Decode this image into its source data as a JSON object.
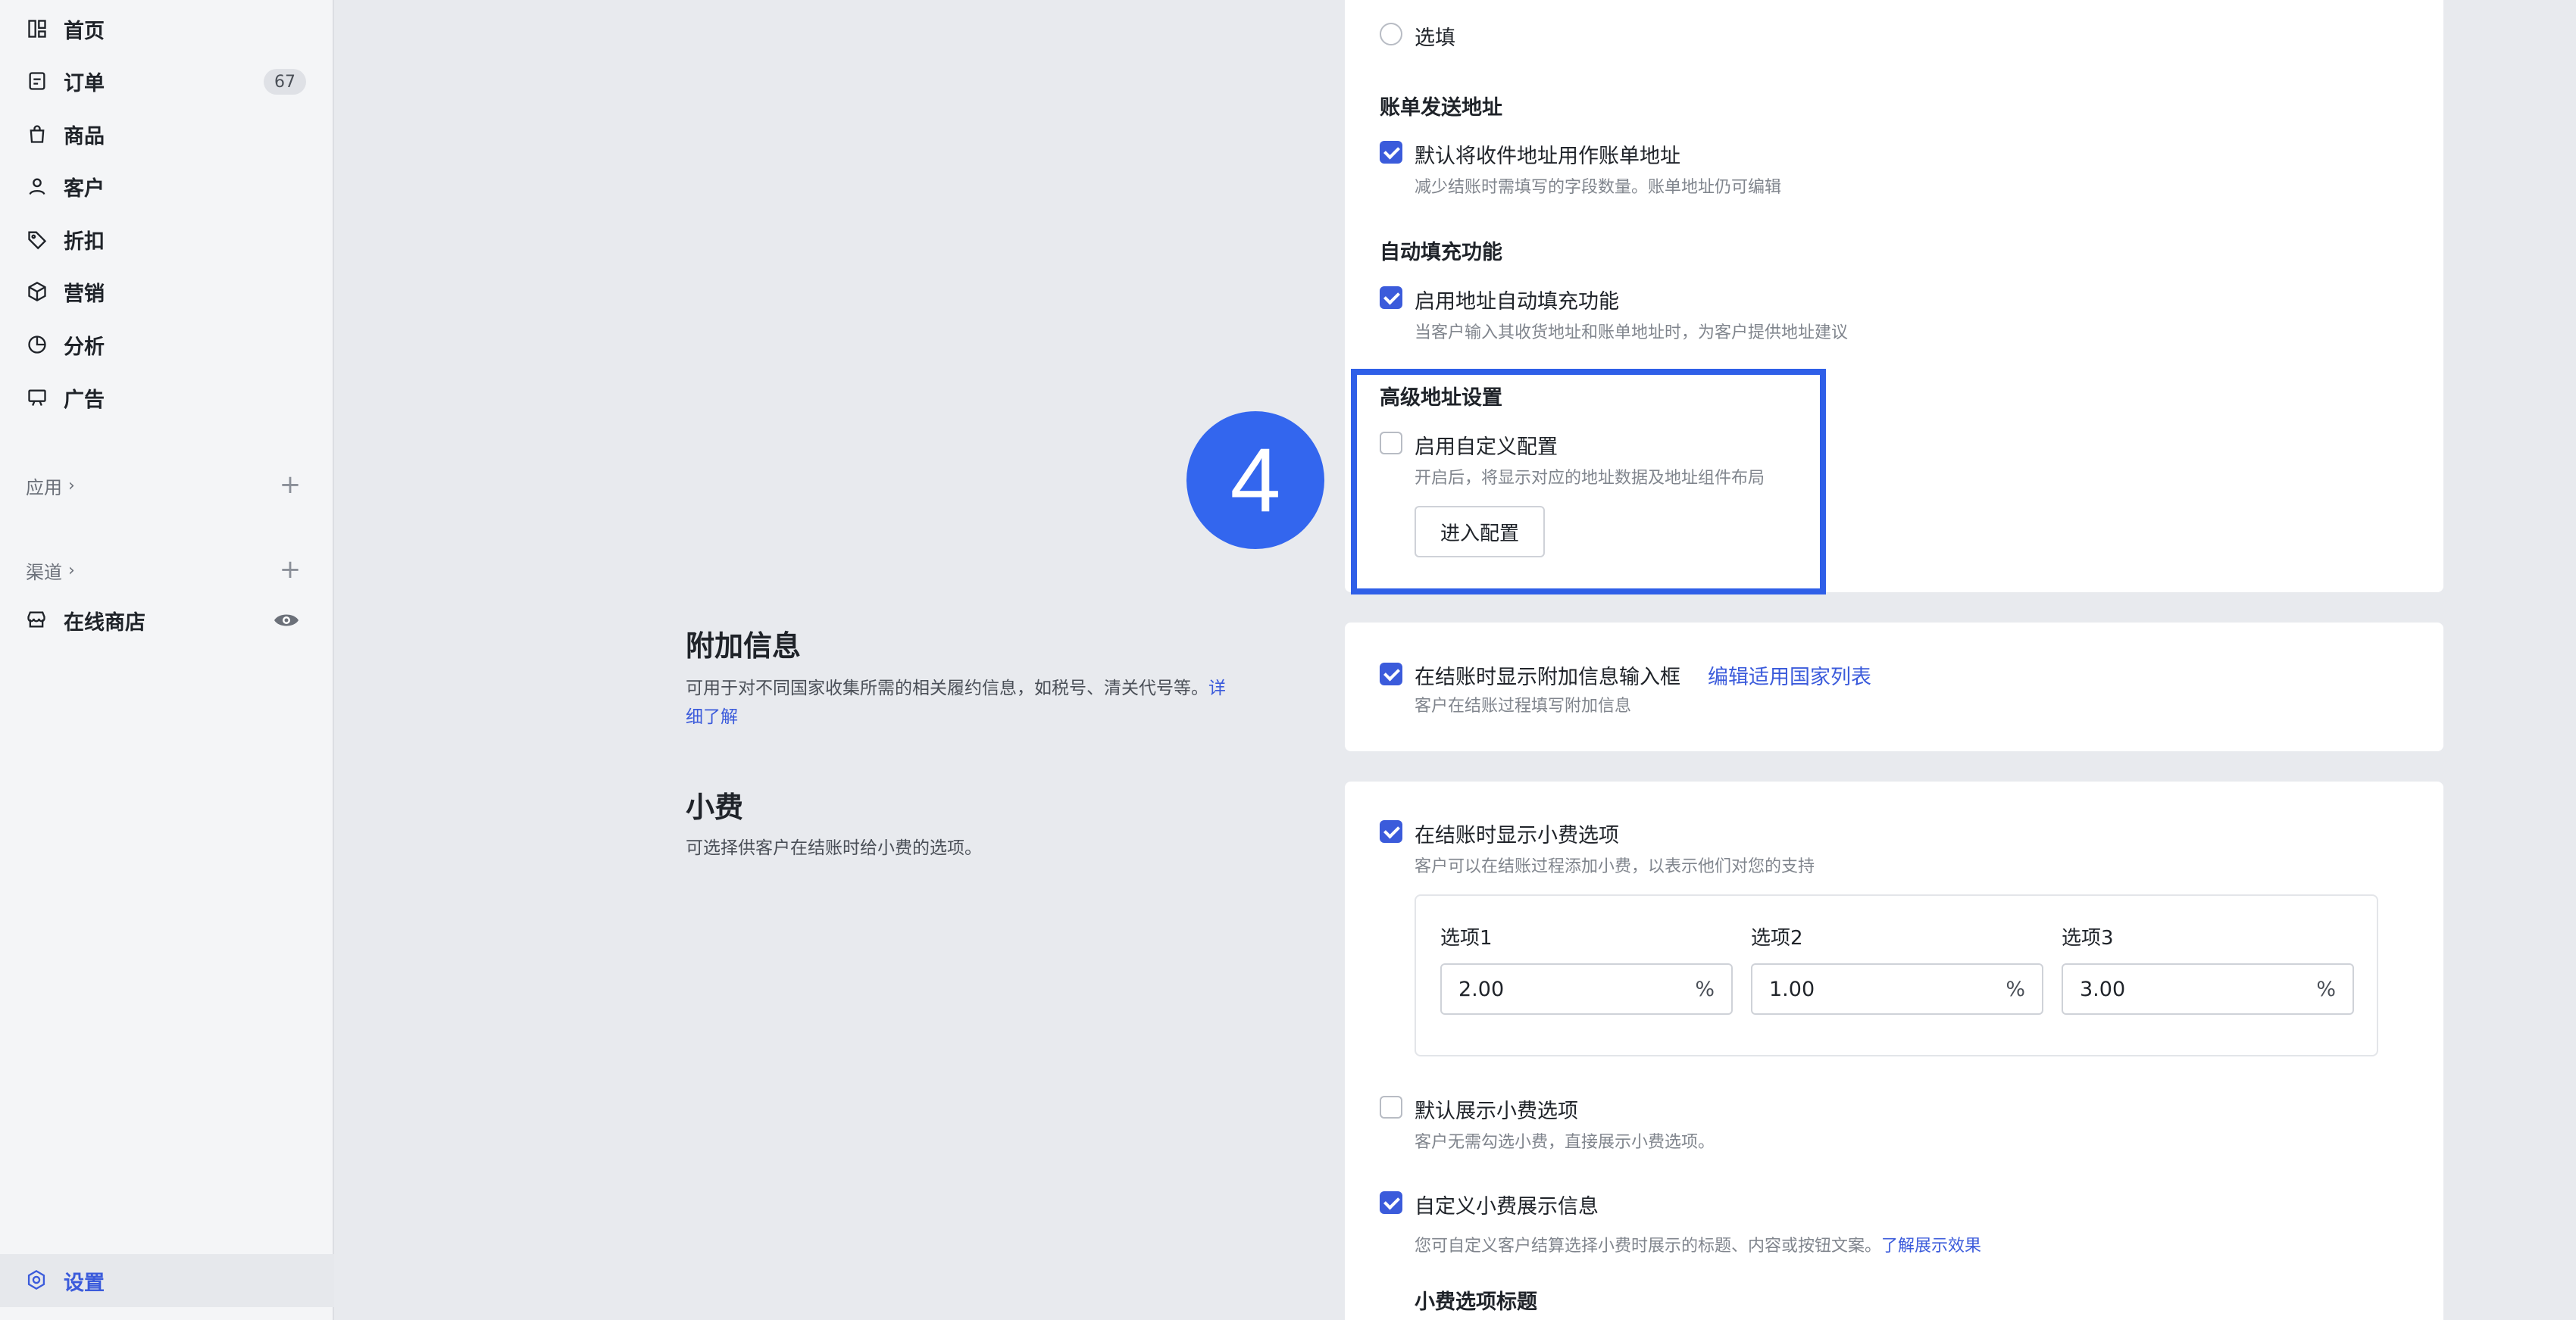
{
  "sidebar": {
    "items": [
      {
        "label": "首页",
        "icon": "home-icon"
      },
      {
        "label": "订单",
        "icon": "orders-icon",
        "badge": "67"
      },
      {
        "label": "商品",
        "icon": "bag-icon"
      },
      {
        "label": "客户",
        "icon": "user-icon"
      },
      {
        "label": "折扣",
        "icon": "tag-icon"
      },
      {
        "label": "营销",
        "icon": "cube-icon"
      },
      {
        "label": "分析",
        "icon": "pie-icon"
      },
      {
        "label": "广告",
        "icon": "ad-icon"
      }
    ],
    "apps_label": "应用",
    "channels_label": "渠道",
    "online_store": "在线商店",
    "settings": "设置"
  },
  "checkout": {
    "optional_label": "选填",
    "billing_title": "账单发送地址",
    "billing_check": "默认将收件地址用作账单地址",
    "billing_desc": "减少结账时需填写的字段数量。账单地址仍可编辑",
    "autofill_title": "自动填充功能",
    "autofill_check": "启用地址自动填充功能",
    "autofill_desc": "当客户输入其收货地址和账单地址时，为客户提供地址建议",
    "advanced_title": "高级地址设置",
    "custom_check": "启用自定义配置",
    "custom_desc": "开启后，将显示对应的地址数据及地址组件布局",
    "enter_config": "进入配置",
    "step_number": "4"
  },
  "extra_info": {
    "title": "附加信息",
    "desc": "可用于对不同国家收集所需的相关履约信息，如税号、清关代号等。",
    "learn_more": "详细了解",
    "check": "在结账时显示附加信息输入框",
    "edit_link": "编辑适用国家列表",
    "check_desc": "客户在结账过程填写附加信息"
  },
  "tips": {
    "title": "小费",
    "desc": "可选择供客户在结账时给小费的选项。",
    "show_check": "在结账时显示小费选项",
    "show_desc": "客户可以在结账过程添加小费，以表示他们对您的支持",
    "options": [
      {
        "label": "选项1",
        "value": "2.00",
        "unit": "%"
      },
      {
        "label": "选项2",
        "value": "1.00",
        "unit": "%"
      },
      {
        "label": "选项3",
        "value": "3.00",
        "unit": "%"
      }
    ],
    "default_check": "默认展示小费选项",
    "default_desc": "客户无需勾选小费，直接展示小费选项。",
    "custom_check": "自定义小费展示信息",
    "custom_desc": "您可自定义客户结算选择小费时展示的标题、内容或按钮文案。",
    "custom_link": "了解展示效果",
    "tip_title_label": "小费选项标题"
  }
}
